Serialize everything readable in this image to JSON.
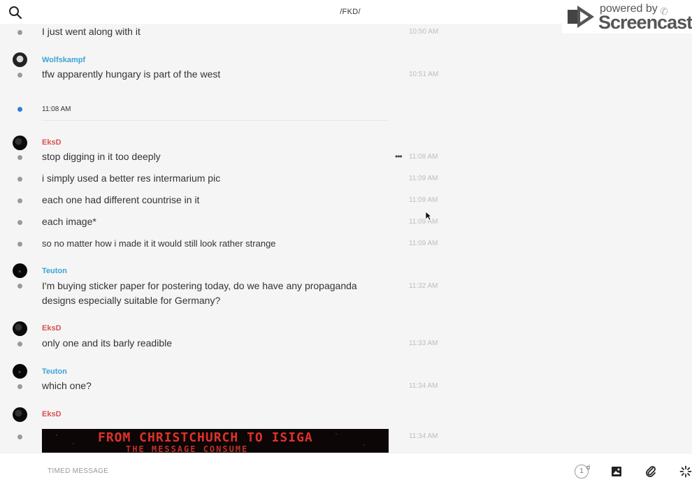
{
  "header": {
    "channel_title": "/FKD/",
    "search_icon": "search-icon"
  },
  "watermark": {
    "powered_by": "powered by",
    "brand": "Screencastify"
  },
  "messages": [
    {
      "text": "I just went along with it",
      "time": "10:50 AM"
    },
    {
      "author": "Wolfskampf",
      "author_color": "#3ba3d6",
      "text": "tfw apparently hungary is part of the west",
      "time": "10:51 AM"
    },
    {
      "separator_time": "11:08 AM"
    },
    {
      "author": "EksD",
      "author_color": "#d9534f",
      "text": "stop digging in it too deeply",
      "time": "11:08 AM"
    },
    {
      "text": "i simply used a better res intermarium pic",
      "time": "11:09 AM"
    },
    {
      "text": "each one had different countrise in it",
      "time": "11:09 AM"
    },
    {
      "text": "each image*",
      "time": "11:09 AM"
    },
    {
      "text": "so no matter how i made it it would still look rather strange",
      "time": "11:09 AM"
    },
    {
      "author": "Teuton",
      "author_color": "#3ba3d6",
      "text_line1": "I'm buying sticker paper for postering today, do we have any propaganda",
      "text_line2": "designs especially suitable for Germany?",
      "time": "11:32 AM"
    },
    {
      "author": "EksD",
      "author_color": "#d9534f",
      "text": "only one and its barly readible",
      "time": "11:33 AM"
    },
    {
      "author": "Teuton",
      "author_color": "#3ba3d6",
      "text": "which one?",
      "time": "11:34 AM"
    },
    {
      "author": "EksD",
      "author_color": "#d9534f",
      "image_text_line1": "FROM CHRISTCHURCH TO ISIGA",
      "image_text_line2": "THE MESSAGE CONSUME",
      "time": "11:34 AM"
    }
  ],
  "composer": {
    "placeholder": "TIMED MESSAGE",
    "timer_value": "1",
    "timer_unit": "d",
    "icons": [
      "timer-icon",
      "image-icon",
      "attachment-icon",
      "loading-icon"
    ]
  },
  "colors": {
    "accent_blue": "#3ba3d6",
    "accent_red": "#d9534f",
    "unread_dot": "#2f7fd6"
  }
}
